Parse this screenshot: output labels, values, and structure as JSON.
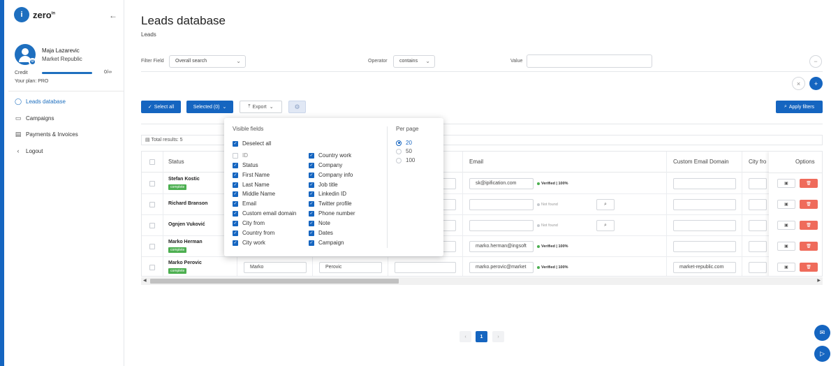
{
  "app": {
    "logo_text": "zero",
    "logo_sup": "in"
  },
  "user": {
    "name": "Maja Lazarevic",
    "company": "Market Republic",
    "credit_label": "Credit",
    "credit_value": "0/∞",
    "plan": "Your plan: PRO"
  },
  "sidebar": {
    "items": [
      {
        "label": "Leads database",
        "icon": "search-icon"
      },
      {
        "label": "Campaigns",
        "icon": "folder-icon"
      },
      {
        "label": "Payments & Invoices",
        "icon": "card-icon"
      },
      {
        "label": "Logout",
        "icon": "chevron-left-icon"
      }
    ]
  },
  "page": {
    "title": "Leads database",
    "breadcrumb": "Leads"
  },
  "filter": {
    "field_label": "Filter Field",
    "field_value": "Overall search",
    "operator_label": "Operator",
    "operator_value": "contains",
    "value_label": "Value",
    "value": ""
  },
  "toolbar": {
    "select_all": "Select all",
    "selected": "Selected (0)",
    "export": "Export",
    "apply_filters": "Apply filters"
  },
  "results": {
    "total": "Total results: 5"
  },
  "table": {
    "headers": {
      "status": "Status",
      "email": "Email",
      "custom_domain": "Custom Email Domain",
      "city_from": "City fro",
      "options": "Options"
    },
    "rows": [
      {
        "name": "Stefan Kostic",
        "status": "complete",
        "first": "",
        "last": "",
        "email": "sk@ipification.com",
        "verify": "Verified | 100%",
        "domain": ""
      },
      {
        "name": "Richard Branson",
        "status": "",
        "first": "",
        "last": "",
        "email": "",
        "verify": "Not found",
        "domain": ""
      },
      {
        "name": "Ognjen Vuković",
        "status": "",
        "first": "",
        "last": "",
        "email": "",
        "verify": "Not found",
        "domain": ""
      },
      {
        "name": "Marko Herman",
        "status": "complete",
        "first": "",
        "last": "",
        "email": "marko.herman@ingsoft",
        "verify": "Verified | 100%",
        "domain": ""
      },
      {
        "name": "Marko Perovic",
        "status": "complete",
        "first": "Marko",
        "last": "Perovic",
        "email": "marko.perovic@market",
        "verify": "Verified | 100%",
        "domain": "market-republic.com"
      }
    ]
  },
  "pagination": {
    "current": "1",
    "prev": "‹",
    "next": "›"
  },
  "visible_fields": {
    "title": "Visible fields",
    "deselect_all": "Deselect all",
    "col1": [
      {
        "label": "ID",
        "checked": false
      },
      {
        "label": "Status",
        "checked": true
      },
      {
        "label": "First Name",
        "checked": true
      },
      {
        "label": "Last Name",
        "checked": true
      },
      {
        "label": "Middle Name",
        "checked": true
      },
      {
        "label": "Email",
        "checked": true
      },
      {
        "label": "Custom email domain",
        "checked": true
      },
      {
        "label": "City from",
        "checked": true
      },
      {
        "label": "Country from",
        "checked": true
      },
      {
        "label": "City work",
        "checked": true
      }
    ],
    "col2": [
      {
        "label": "Country work",
        "checked": true
      },
      {
        "label": "Company",
        "checked": true
      },
      {
        "label": "Company info",
        "checked": true
      },
      {
        "label": "Job title",
        "checked": true
      },
      {
        "label": "Linkedin ID",
        "checked": true
      },
      {
        "label": "Twitter profile",
        "checked": true
      },
      {
        "label": "Phone number",
        "checked": true
      },
      {
        "label": "Note",
        "checked": true
      },
      {
        "label": "Dates",
        "checked": true
      },
      {
        "label": "Campaign",
        "checked": true
      }
    ],
    "per_page_title": "Per page",
    "per_page_options": [
      "20",
      "50",
      "100"
    ],
    "per_page_selected": "20"
  }
}
